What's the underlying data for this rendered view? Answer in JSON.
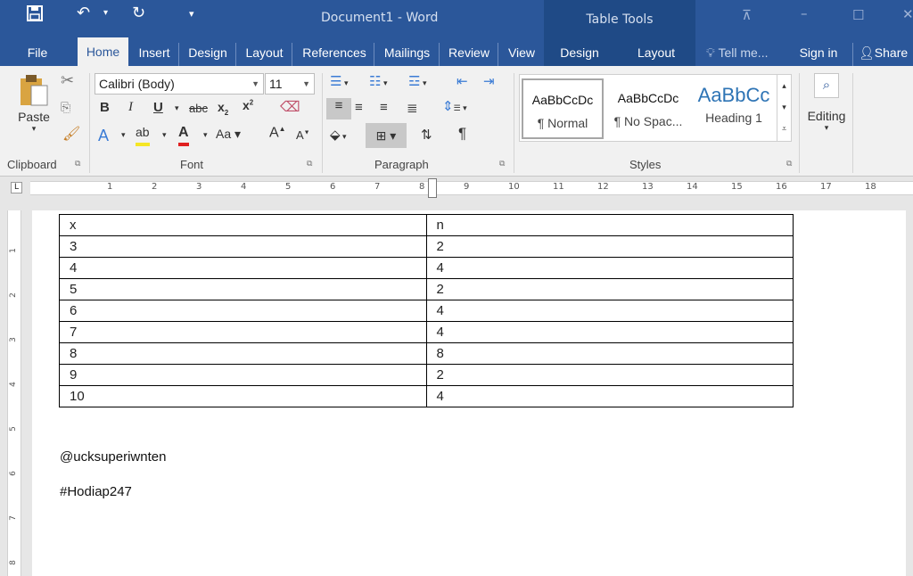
{
  "titlebar": {
    "title": "Document1 - Word",
    "contextual_title": "Table Tools",
    "qa_save_icon": "save-icon",
    "qa_undo_icon": "undo-icon",
    "qa_redo_icon": "redo-icon"
  },
  "tabs": [
    {
      "label": "File"
    },
    {
      "label": "Home"
    },
    {
      "label": "Insert"
    },
    {
      "label": "Design"
    },
    {
      "label": "Layout"
    },
    {
      "label": "References"
    },
    {
      "label": "Mailings"
    },
    {
      "label": "Review"
    },
    {
      "label": "View"
    },
    {
      "label": "Design"
    },
    {
      "label": "Layout"
    }
  ],
  "tell_me": "Tell me...",
  "sign_in": "Sign in",
  "share": "Share",
  "ribbon": {
    "clipboard": {
      "label": "Clipboard",
      "paste": "Paste"
    },
    "font": {
      "label": "Font",
      "font_name": "Calibri (Body)",
      "font_size": "11",
      "change_case": "Aa"
    },
    "paragraph": {
      "label": "Paragraph"
    },
    "styles": {
      "label": "Styles",
      "tiles": [
        {
          "preview": "AaBbCcDc",
          "name": "¶ Normal"
        },
        {
          "preview": "AaBbCcDc",
          "name": "¶ No Spac..."
        },
        {
          "preview": "AaBbCc",
          "name": "Heading 1"
        }
      ]
    },
    "editing": {
      "label": "Editing"
    }
  },
  "ruler_numbers": [
    "1",
    "2",
    "3",
    "4",
    "5",
    "6",
    "7",
    "8",
    "9",
    "10",
    "11",
    "12",
    "13",
    "14",
    "15",
    "16",
    "17",
    "18"
  ],
  "vruler_numbers": [
    "1",
    "2",
    "3",
    "4",
    "5",
    "6",
    "7",
    "8"
  ],
  "document": {
    "table": [
      [
        "x",
        "n"
      ],
      [
        "3",
        "2"
      ],
      [
        "4",
        "4"
      ],
      [
        "5",
        "2"
      ],
      [
        "6",
        "4"
      ],
      [
        "7",
        "4"
      ],
      [
        "8",
        "8"
      ],
      [
        "9",
        "2"
      ],
      [
        "10",
        "4"
      ]
    ],
    "paragraphs": [
      "@ucksuperiwnten",
      "#Hodiap247"
    ]
  }
}
